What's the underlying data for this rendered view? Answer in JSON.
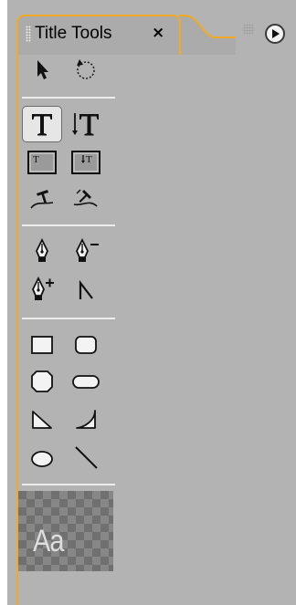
{
  "panel": {
    "tab_title": "Title Tools",
    "close_glyph": "×",
    "accent_color": "#f2a925",
    "background_color": "#b3b3b3",
    "menu_icon": "panel-menu-icon"
  },
  "tools": [
    {
      "name": "selection-tool",
      "icon": "arrow-cursor-icon",
      "active": false
    },
    {
      "name": "rotation-tool",
      "icon": "rotate-icon",
      "active": false
    },
    {
      "name": "type-tool",
      "icon": "horizontal-type-icon",
      "active": true
    },
    {
      "name": "vertical-type-tool",
      "icon": "vertical-type-icon",
      "active": false
    },
    {
      "name": "area-type-tool",
      "icon": "area-type-icon",
      "active": false
    },
    {
      "name": "vertical-area-type-tool",
      "icon": "vertical-area-type-icon",
      "active": false
    },
    {
      "name": "path-type-tool",
      "icon": "path-type-icon",
      "active": false
    },
    {
      "name": "vertical-path-type-tool",
      "icon": "vertical-path-type-icon",
      "active": false
    },
    {
      "name": "pen-tool",
      "icon": "pen-icon",
      "active": false
    },
    {
      "name": "delete-anchor-point-tool",
      "icon": "pen-minus-icon",
      "active": false
    },
    {
      "name": "add-anchor-point-tool",
      "icon": "pen-plus-icon",
      "active": false
    },
    {
      "name": "convert-anchor-point-tool",
      "icon": "convert-point-icon",
      "active": false
    },
    {
      "name": "rectangle-tool",
      "icon": "rectangle-icon",
      "active": false
    },
    {
      "name": "rounded-corner-rectangle-tool",
      "icon": "rounded-rectangle-icon",
      "active": false
    },
    {
      "name": "clipped-corner-rectangle-tool",
      "icon": "clipped-rectangle-icon",
      "active": false
    },
    {
      "name": "rounded-rectangle-tool",
      "icon": "pill-icon",
      "active": false
    },
    {
      "name": "wedge-tool",
      "icon": "wedge-icon",
      "active": false
    },
    {
      "name": "arc-tool",
      "icon": "arc-icon",
      "active": false
    },
    {
      "name": "ellipse-tool",
      "icon": "ellipse-icon",
      "active": false
    },
    {
      "name": "line-tool",
      "icon": "line-icon",
      "active": false
    }
  ],
  "style_preview": {
    "sample_text": "Aa"
  }
}
